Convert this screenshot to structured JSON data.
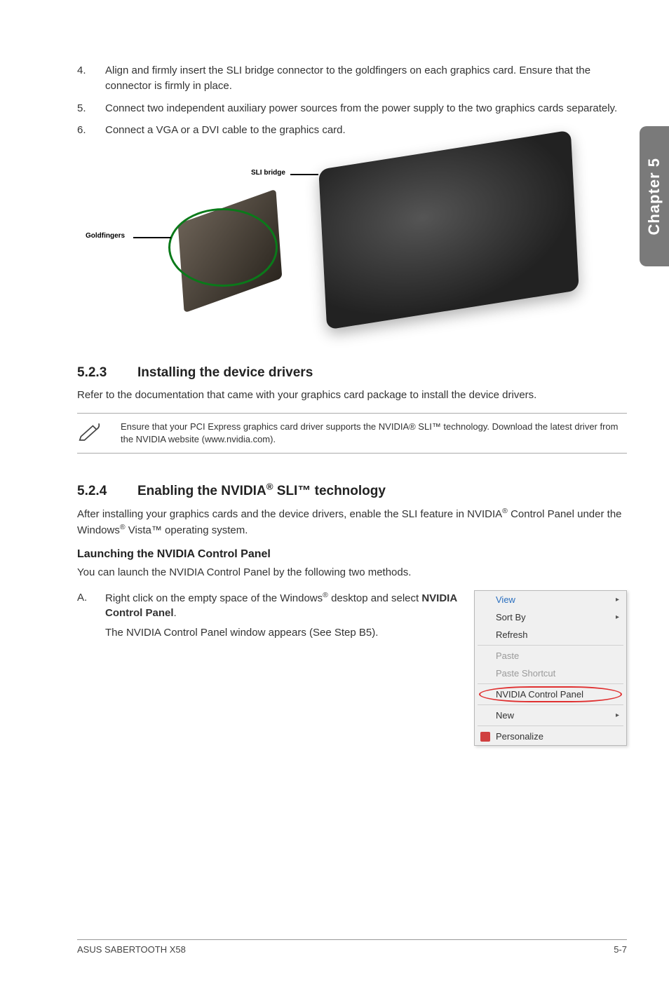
{
  "side_tab": "Chapter 5",
  "steps_top": [
    {
      "num": "4.",
      "text": "Align and firmly insert the SLI bridge connector to the goldfingers on each graphics card. Ensure that the connector is firmly in place."
    },
    {
      "num": "5.",
      "text": "Connect two independent auxiliary power sources from the power supply to the two graphics cards separately."
    },
    {
      "num": "6.",
      "text": "Connect a VGA or a DVI cable to the graphics card."
    }
  ],
  "fig": {
    "goldfingers": "Goldfingers",
    "sli_bridge": "SLI bridge"
  },
  "sec523": {
    "num": "5.2.3",
    "title": "Installing the device drivers",
    "body": "Refer to the documentation that came with your graphics card package to install the device drivers."
  },
  "note523": "Ensure that your PCI Express graphics card driver supports the NVIDIA® SLI™ technology. Download the latest driver from the NVIDIA website (www.nvidia.com).",
  "sec524": {
    "num": "5.2.4",
    "title_pre": "Enabling the NVIDIA",
    "title_post": " SLI™ technology",
    "body_pre": "After installing your graphics cards and the device drivers, enable the SLI feature in NVIDIA",
    "body_mid": " Control Panel under the Windows",
    "body_post": " Vista™ operating system."
  },
  "launch": {
    "heading": "Launching the NVIDIA Control Panel",
    "intro": "You can launch the NVIDIA Control Panel by the following two methods.",
    "a_label": "A.",
    "a_line1_pre": "Right click on the empty space of the Windows",
    "a_line1_post": " desktop and select ",
    "a_line1_bold": "NVIDIA Control Panel",
    "a_line1_end": ".",
    "a_line2": "The NVIDIA Control Panel window appears (See Step B5)."
  },
  "menu": {
    "view": "View",
    "sort_by": "Sort By",
    "refresh": "Refresh",
    "paste": "Paste",
    "paste_shortcut": "Paste Shortcut",
    "nvidia": "NVIDIA Control Panel",
    "new": "New",
    "personalize": "Personalize"
  },
  "footer": {
    "left": "ASUS SABERTOOTH X58",
    "right": "5-7"
  },
  "reg": "®"
}
